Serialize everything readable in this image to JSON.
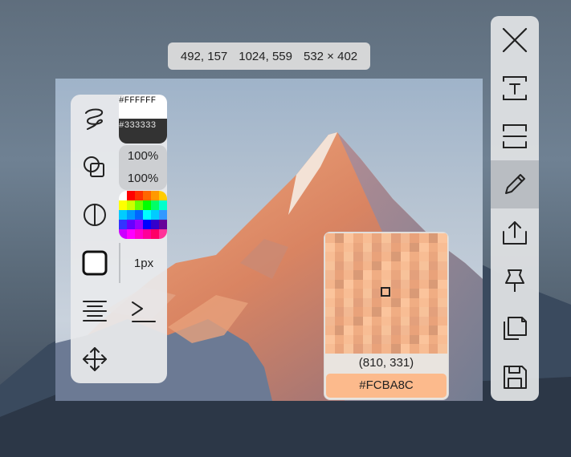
{
  "selection": {
    "start": "492, 157",
    "end": "1024, 559",
    "size": "532 × 402"
  },
  "left_toolbar": {
    "tools": [
      {
        "name": "brush-tool",
        "icon": "curve-icon"
      },
      {
        "name": "shape-tool",
        "icon": "shapes-icon"
      },
      {
        "name": "mosaic-tool",
        "icon": "half-circle-icon"
      },
      {
        "name": "fill-toggle",
        "icon": "rounded-square-icon"
      },
      {
        "name": "text-align-tool",
        "icon": "align-lines-icon"
      },
      {
        "name": "move-tool",
        "icon": "move-arrows-icon"
      },
      {
        "name": "text-cursor-tool",
        "icon": "prompt-icon"
      }
    ],
    "color_primary": "#FFFFFF",
    "color_secondary": "#333333",
    "opacity_1": "100%",
    "opacity_2": "100%",
    "stroke_width": "1px",
    "palette": [
      "#ffffff",
      "#ff0000",
      "#ff3000",
      "#ff6600",
      "#ff9900",
      "#ffcc00",
      "#ffff00",
      "#ccff00",
      "#66ff00",
      "#00ff00",
      "#00ff66",
      "#00ffcc",
      "#00ccff",
      "#0099ff",
      "#0066ff",
      "#00ffff",
      "#00ccff",
      "#3399ff",
      "#3333ff",
      "#6600ff",
      "#9900ff",
      "#0000ff",
      "#3300cc",
      "#660099",
      "#cc00ff",
      "#ff00ff",
      "#ff00cc",
      "#ff0099",
      "#ff0066",
      "#ff3399"
    ]
  },
  "right_toolbar": {
    "tools": [
      {
        "name": "close-button",
        "icon": "close-icon"
      },
      {
        "name": "ocr-button",
        "icon": "text-box-icon"
      },
      {
        "name": "long-screenshot-button",
        "icon": "scroll-capture-icon"
      },
      {
        "name": "draw-button",
        "icon": "pencil-icon",
        "active": true
      },
      {
        "name": "share-button",
        "icon": "share-icon"
      },
      {
        "name": "pin-button",
        "icon": "pin-icon"
      },
      {
        "name": "copy-button",
        "icon": "copy-icon"
      },
      {
        "name": "save-button",
        "icon": "save-icon"
      }
    ]
  },
  "magnifier": {
    "position": "(810, 331)",
    "hex": "#FCBA8C",
    "hex_color": "#FCBA8C"
  }
}
